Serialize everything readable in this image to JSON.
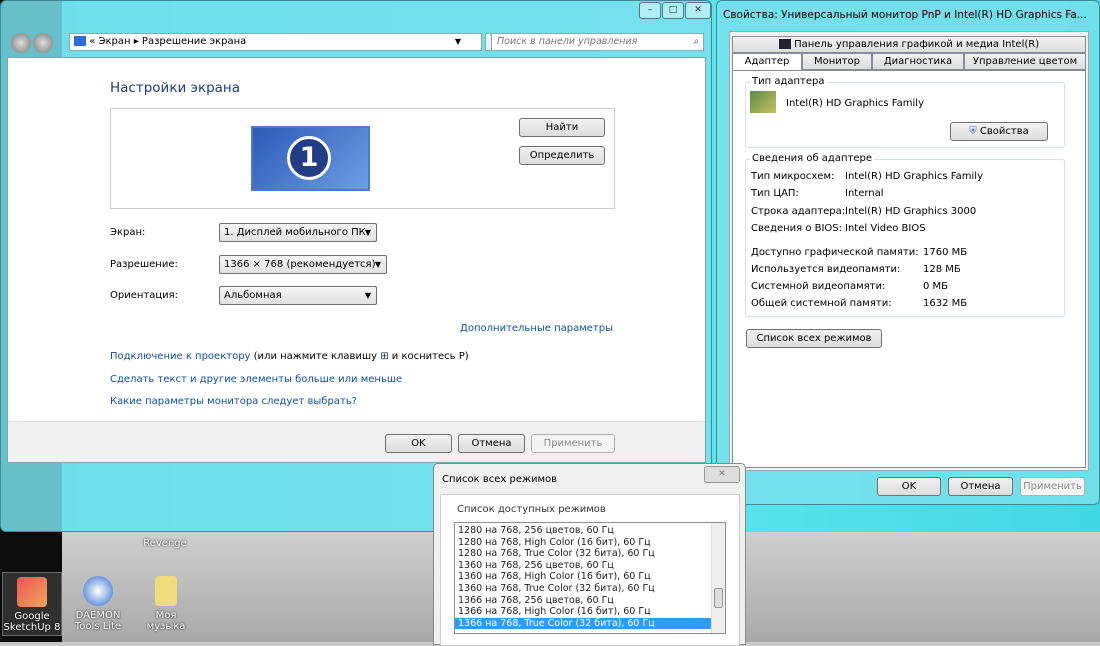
{
  "desktop": {
    "icons": [
      {
        "label": "Revenge"
      },
      {
        "label": "Google SketchUp 8"
      },
      {
        "label": "DAEMON Tools Lite"
      },
      {
        "label": "Моя музыка"
      }
    ]
  },
  "main_window": {
    "breadcrumb": [
      "Экран",
      "Разрешение экрана"
    ],
    "search_placeholder": "Поиск в панели управления",
    "heading": "Настройки экрана",
    "monitor_number": "1",
    "find_button": "Найти",
    "identify_button": "Определить",
    "display_label": "Экран:",
    "display_value": "1. Дисплей мобильного ПК",
    "resolution_label": "Разрешение:",
    "resolution_value": "1366 × 768 (рекомендуется)",
    "orientation_label": "Ориентация:",
    "orientation_value": "Альбомная",
    "advanced_link": "Дополнительные параметры",
    "projector_link": "Подключение к проектору",
    "projector_hint_before": "(или нажмите клавишу",
    "projector_hint_after": "и коснитесь P)",
    "text_size_link": "Сделать текст и другие элементы больше или меньше",
    "which_settings_link": "Какие параметры монитора следует выбрать?",
    "ok": "OK",
    "cancel": "Отмена",
    "apply": "Применить"
  },
  "props_dialog": {
    "title": "Свойства: Универсальный монитор PnP и Intel(R) HD Graphics Fa...",
    "tabs_top": [
      "Панель управления графикой и медиа Intel(R)"
    ],
    "tabs": [
      "Адаптер",
      "Монитор",
      "Диагностика",
      "Управление цветом"
    ],
    "active_tab": "Адаптер",
    "adapter_type_group": "Тип адаптера",
    "adapter_name": "Intel(R) HD Graphics Family",
    "properties_button": "Свойства",
    "adapter_info_group": "Сведения об адаптере",
    "info": [
      {
        "label": "Тип микросхем:",
        "value": "Intel(R) HD Graphics Family"
      },
      {
        "label": "Тип ЦАП:",
        "value": "Internal"
      },
      {
        "label": "Строка адаптера:",
        "value": "Intel(R) HD Graphics 3000"
      },
      {
        "label": "Сведения о BIOS:",
        "value": "Intel Video BIOS"
      }
    ],
    "memory": [
      {
        "label": "Доступно графической памяти:",
        "value": "1760 МБ"
      },
      {
        "label": "Используется видеопамяти:",
        "value": "128 МБ"
      },
      {
        "label": "Системной видеопамяти:",
        "value": "0 МБ"
      },
      {
        "label": "Общей системной памяти:",
        "value": "1632 МБ"
      }
    ],
    "list_modes_button": "Список всех режимов",
    "ok": "OK",
    "cancel": "Отмена",
    "apply": "Применить"
  },
  "modes_dialog": {
    "title": "Список всех режимов",
    "group": "Список доступных режимов",
    "modes": [
      "1280 на 768, 256 цветов, 60 Гц",
      "1280 на 768, High Color (16 бит), 60 Гц",
      "1280 на 768, True Color (32 бита), 60 Гц",
      "1360 на 768, 256 цветов, 60 Гц",
      "1360 на 768, High Color (16 бит), 60 Гц",
      "1360 на 768, True Color (32 бита), 60 Гц",
      "1366 на 768, 256 цветов, 60 Гц",
      "1366 на 768, High Color (16 бит), 60 Гц",
      "1366 на 768, True Color (32 бита), 60 Гц"
    ],
    "selected_index": 8
  }
}
